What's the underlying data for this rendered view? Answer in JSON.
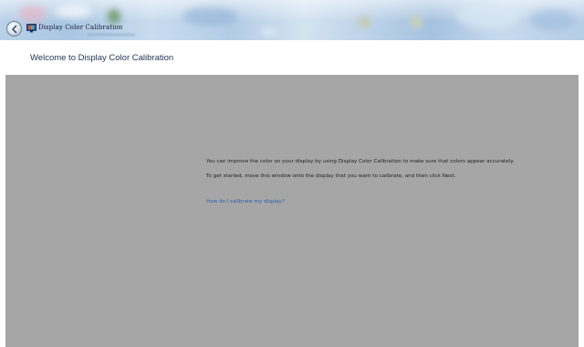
{
  "window": {
    "title": "Display Color Calibration"
  },
  "header": {
    "page_title": "Welcome to Display Color Calibration"
  },
  "content": {
    "paragraph_1": "You can improve the color on your display by using Display Color Calibration to make sure that colors appear accurately.",
    "paragraph_2": "To get started, move this window onto the display that you want to calibrate, and then click Next.",
    "help_link": "How do I calibrate my display?"
  },
  "icons": {
    "back": "back-arrow-icon",
    "app": "display-icon"
  },
  "colors": {
    "content_background": "#a6a6a6",
    "link": "#2c5fb0",
    "title_text": "#1e3552"
  }
}
